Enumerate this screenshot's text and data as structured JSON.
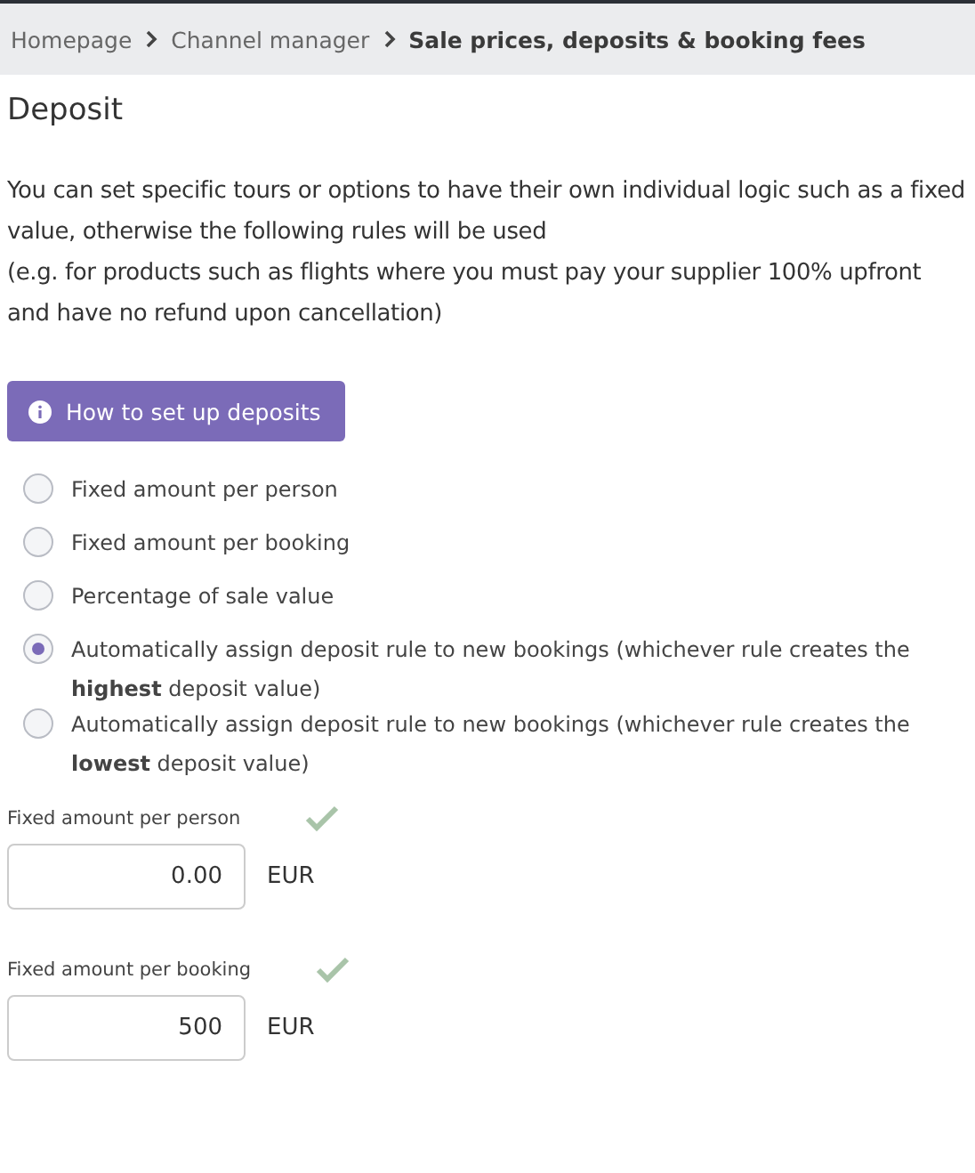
{
  "breadcrumbs": [
    {
      "label": "Homepage",
      "current": false
    },
    {
      "label": "Channel manager",
      "current": false
    },
    {
      "label": "Sale prices, deposits & booking fees",
      "current": true
    }
  ],
  "heading": "Deposit",
  "description": [
    "You can set specific tours or options to have their own individual logic such as a fixed value, otherwise the following rules will be used",
    "(e.g. for products such as flights where you must pay your supplier 100% upfront and have no refund upon cancellation)"
  ],
  "help_button": "How to set up deposits",
  "deposit_rules": [
    {
      "label": "Fixed amount per person",
      "selected": false
    },
    {
      "label": "Fixed amount per booking",
      "selected": false
    },
    {
      "label": "Percentage of sale value",
      "selected": false
    },
    {
      "label": "Automatically assign deposit rule to new bookings (whichever rule creates the **highest** deposit value)",
      "selected": true
    },
    {
      "label": "Automatically assign deposit rule to new bookings (whichever rule creates the **lowest** deposit value)",
      "selected": false
    }
  ],
  "amount_fields": [
    {
      "label": "Fixed amount per person",
      "value": "0.00",
      "currency": "EUR",
      "valid": true
    },
    {
      "label": "Fixed amount per booking",
      "value": "500",
      "currency": "EUR",
      "valid": true
    }
  ]
}
